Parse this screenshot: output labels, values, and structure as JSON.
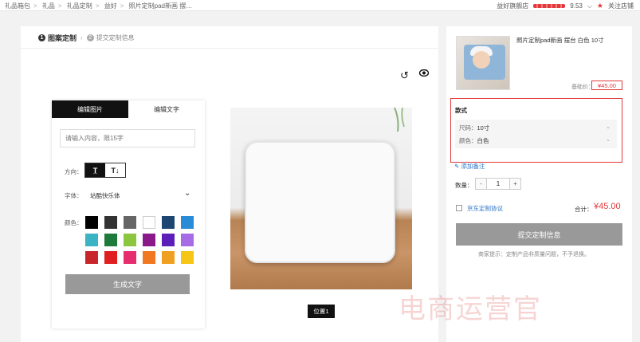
{
  "breadcrumbs": [
    "礼品箱包",
    "礼品",
    "礼品定制",
    "益好",
    "照片定制pad新画 摆…"
  ],
  "shop": {
    "name": "益好旗舰店",
    "score": "9.53",
    "follow": "关注店铺"
  },
  "steps": {
    "step1_num": "1",
    "step1": "图案定制",
    "step2_num": "2",
    "step2": "提交定制信息"
  },
  "editor": {
    "tab_image": "编辑图片",
    "tab_text": "编辑文字",
    "input_placeholder": "请输入内容，限15字",
    "direction_label": "方向：",
    "font_label": "字体：",
    "font_value": "站酷快乐体",
    "color_label": "颜色：",
    "generate": "生成文字",
    "colors": [
      "#000000",
      "#333333",
      "#666666",
      "#ffffff",
      "#1d4670",
      "#2a8bd6",
      "#3ab3c4",
      "#1e7a3a",
      "#8cc63f",
      "#8a1a8a",
      "#5b1eb8",
      "#a86be6",
      "#c8262b",
      "#e02020",
      "#e62e6f",
      "#f07820",
      "#f0a020",
      "#f5c518"
    ]
  },
  "canvas": {
    "position_label": "位置1"
  },
  "product": {
    "title": "照片定制pad新画 摆台 白色 10寸",
    "base_price_label": "基础价：",
    "base_price": "¥45.00",
    "spec_title": "款式",
    "size_label": "尺码：",
    "size_value": "10寸",
    "color_label": "颜色：",
    "color_value": "白色",
    "add_note": "添加备注",
    "qty_label": "数量：",
    "qty_value": "1",
    "agreement": "京东定制协议",
    "total_label": "合计：",
    "total": "¥45.00",
    "submit": "提交定制信息",
    "tip": "商家提示：定制产品非质量问题，不予退换。"
  },
  "watermark": "电商运营官"
}
